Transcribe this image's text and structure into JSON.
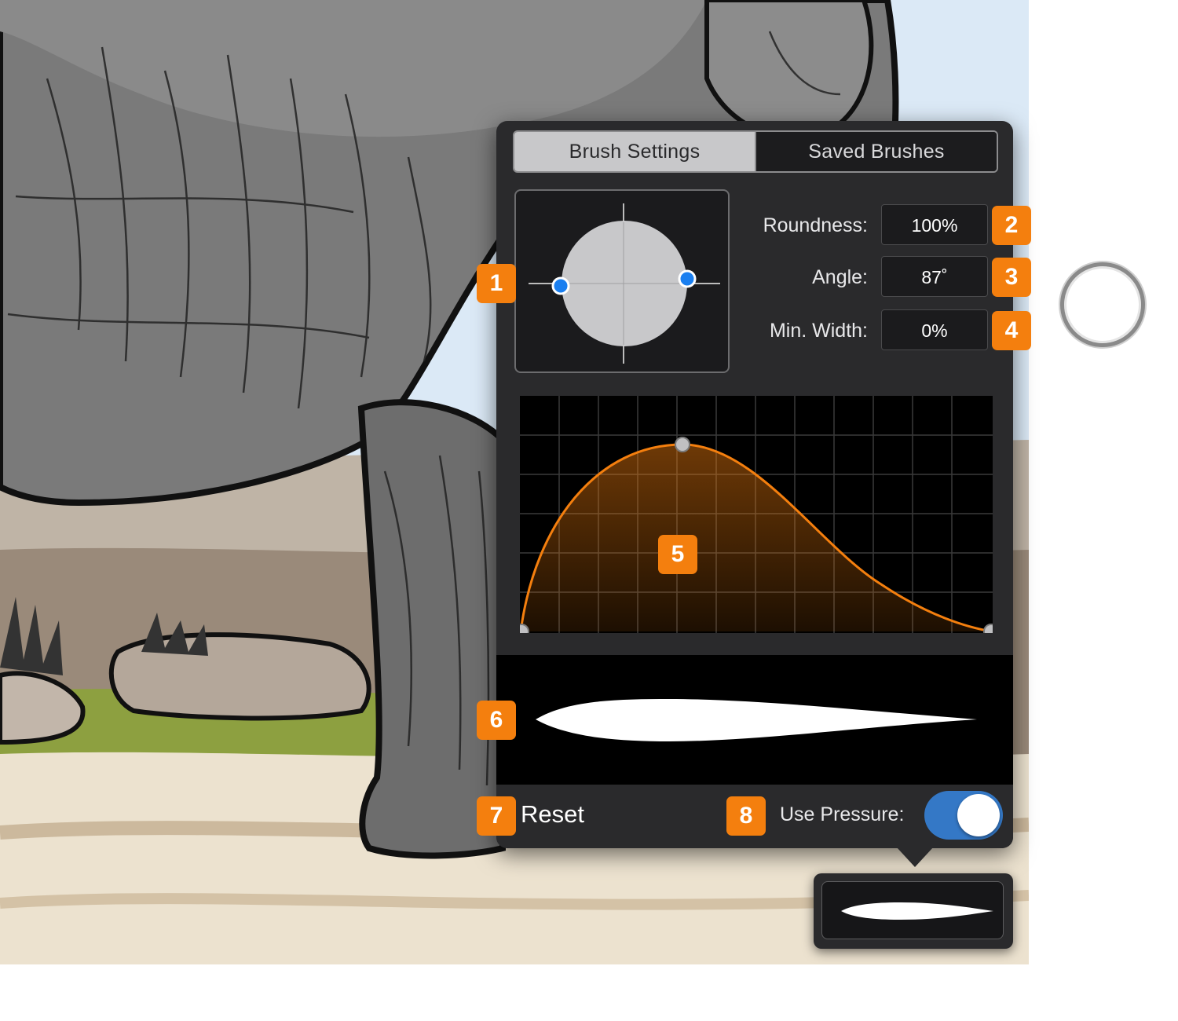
{
  "tabs": [
    {
      "label": "Brush Settings",
      "active": true
    },
    {
      "label": "Saved Brushes",
      "active": false
    }
  ],
  "properties": {
    "roundness": {
      "label": "Roundness:",
      "value": "100%"
    },
    "angle": {
      "label": "Angle:",
      "value": "87˚"
    },
    "min_width": {
      "label": "Min. Width:",
      "value": "0%"
    }
  },
  "bottom": {
    "reset_label": "Reset",
    "pressure_label": "Use Pressure:",
    "pressure_on": true
  },
  "callouts": [
    "1",
    "2",
    "3",
    "4",
    "5",
    "6",
    "7",
    "8"
  ],
  "colors": {
    "accent": "#f47f0e",
    "toggle_on": "#3478c6",
    "handle_blue": "#1a7ff0",
    "panel_bg": "#2a2a2c"
  },
  "icons": {
    "home_button": "home-button",
    "shape_handle": "dot-handle",
    "curve_point": "curve-control-point"
  }
}
